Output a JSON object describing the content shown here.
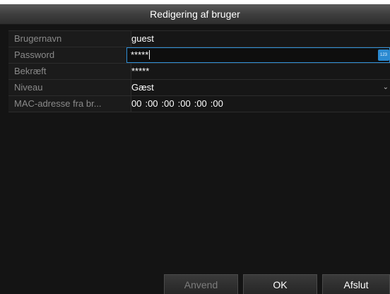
{
  "window": {
    "title": "Redigering af bruger"
  },
  "form": {
    "username": {
      "label": "Brugernavn",
      "value": "guest"
    },
    "password": {
      "label": "Password",
      "value": "*****",
      "keyboard_icon_text": "123"
    },
    "confirm": {
      "label": "Bekræft",
      "value": "*****"
    },
    "level": {
      "label": "Niveau",
      "value": "Gæst"
    },
    "mac": {
      "label": "MAC-adresse fra br...",
      "segments": [
        "00",
        ":00",
        ":00",
        ":00",
        ":00",
        ":00"
      ]
    }
  },
  "buttons": {
    "apply": "Anvend",
    "ok": "OK",
    "exit": "Afslut"
  },
  "colors": {
    "focus_border": "#2f8fd6",
    "background": "#141414",
    "disabled_text": "#7d7d7d"
  },
  "icons": {
    "keyboard": "numeric-keyboard-icon",
    "dropdown": "chevron-down-icon"
  }
}
